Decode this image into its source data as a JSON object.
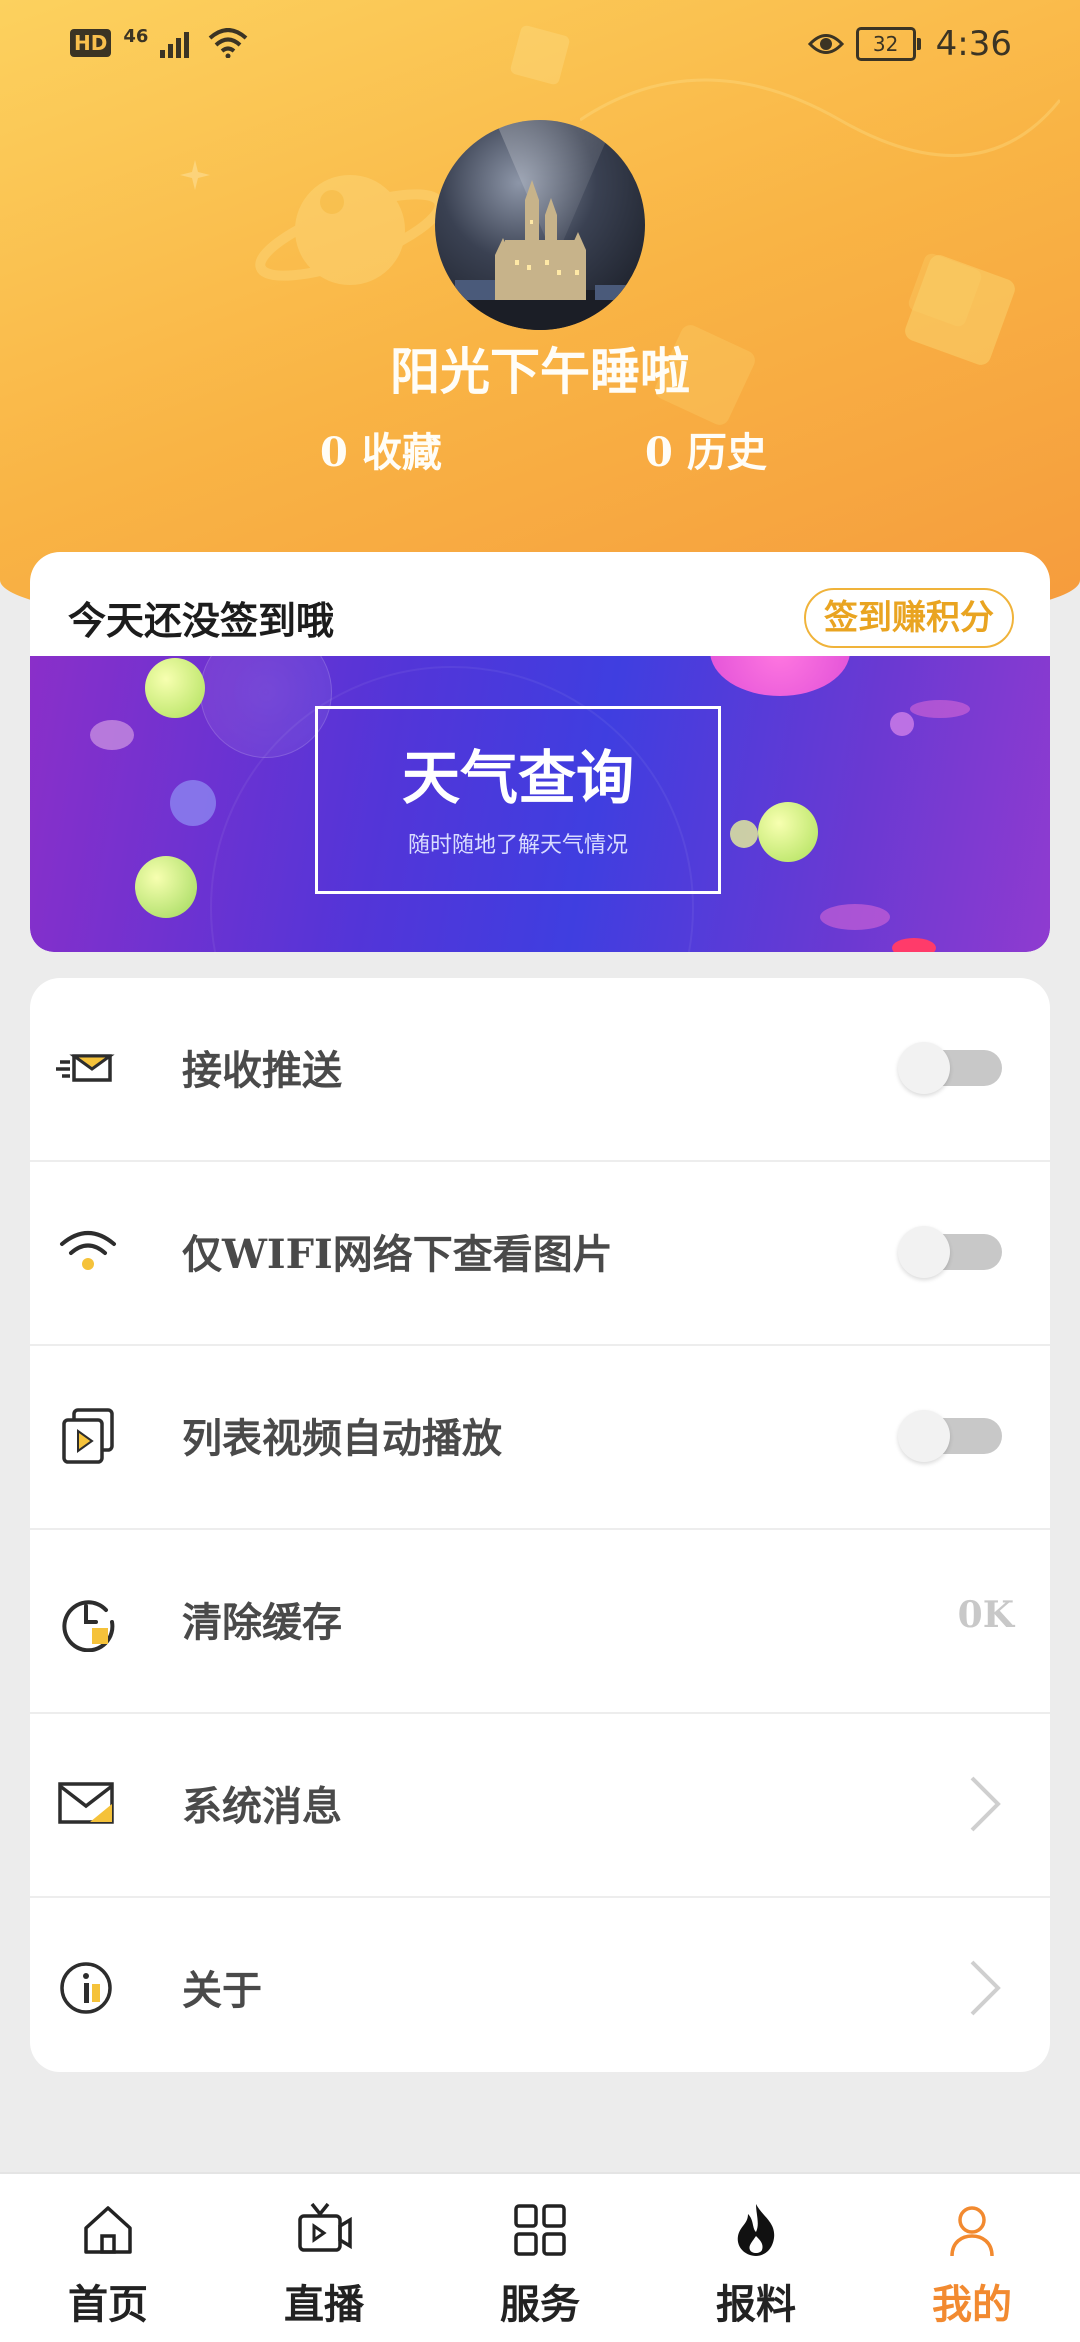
{
  "status_bar": {
    "hd": "HD",
    "network": "46",
    "battery": "32",
    "time": "4:36"
  },
  "profile": {
    "name": "阳光下午睡啦",
    "favorites_count": "0",
    "favorites_label": "收藏",
    "history_count": "0",
    "history_label": "历史"
  },
  "signin": {
    "text": "今天还没签到哦",
    "button": "签到赚积分"
  },
  "banner": {
    "title": "天气查询",
    "subtitle": "随时随地了解天气情况"
  },
  "settings": [
    {
      "label": "接收推送",
      "icon": "mail-send-icon",
      "type": "toggle",
      "on": false
    },
    {
      "label": "仅WIFI网络下查看图片",
      "icon": "wifi-icon",
      "type": "toggle",
      "on": false
    },
    {
      "label": "列表视频自动播放",
      "icon": "video-play-icon",
      "type": "toggle",
      "on": false
    },
    {
      "label": "清除缓存",
      "icon": "clock-clear-icon",
      "type": "value",
      "value": "0K"
    },
    {
      "label": "系统消息",
      "icon": "envelope-icon",
      "type": "link"
    },
    {
      "label": "关于",
      "icon": "info-icon",
      "type": "link"
    }
  ],
  "bottom_nav": [
    {
      "label": "首页",
      "icon": "home-icon"
    },
    {
      "label": "直播",
      "icon": "live-tv-icon"
    },
    {
      "label": "服务",
      "icon": "grid-icon"
    },
    {
      "label": "报料",
      "icon": "fire-icon"
    },
    {
      "label": "我的",
      "icon": "person-icon",
      "active": true
    }
  ],
  "colors": {
    "accent": "#f28a30",
    "header_start": "#fcd15e",
    "header_end": "#f59a3c",
    "banner_blue": "#3f3ee0"
  }
}
